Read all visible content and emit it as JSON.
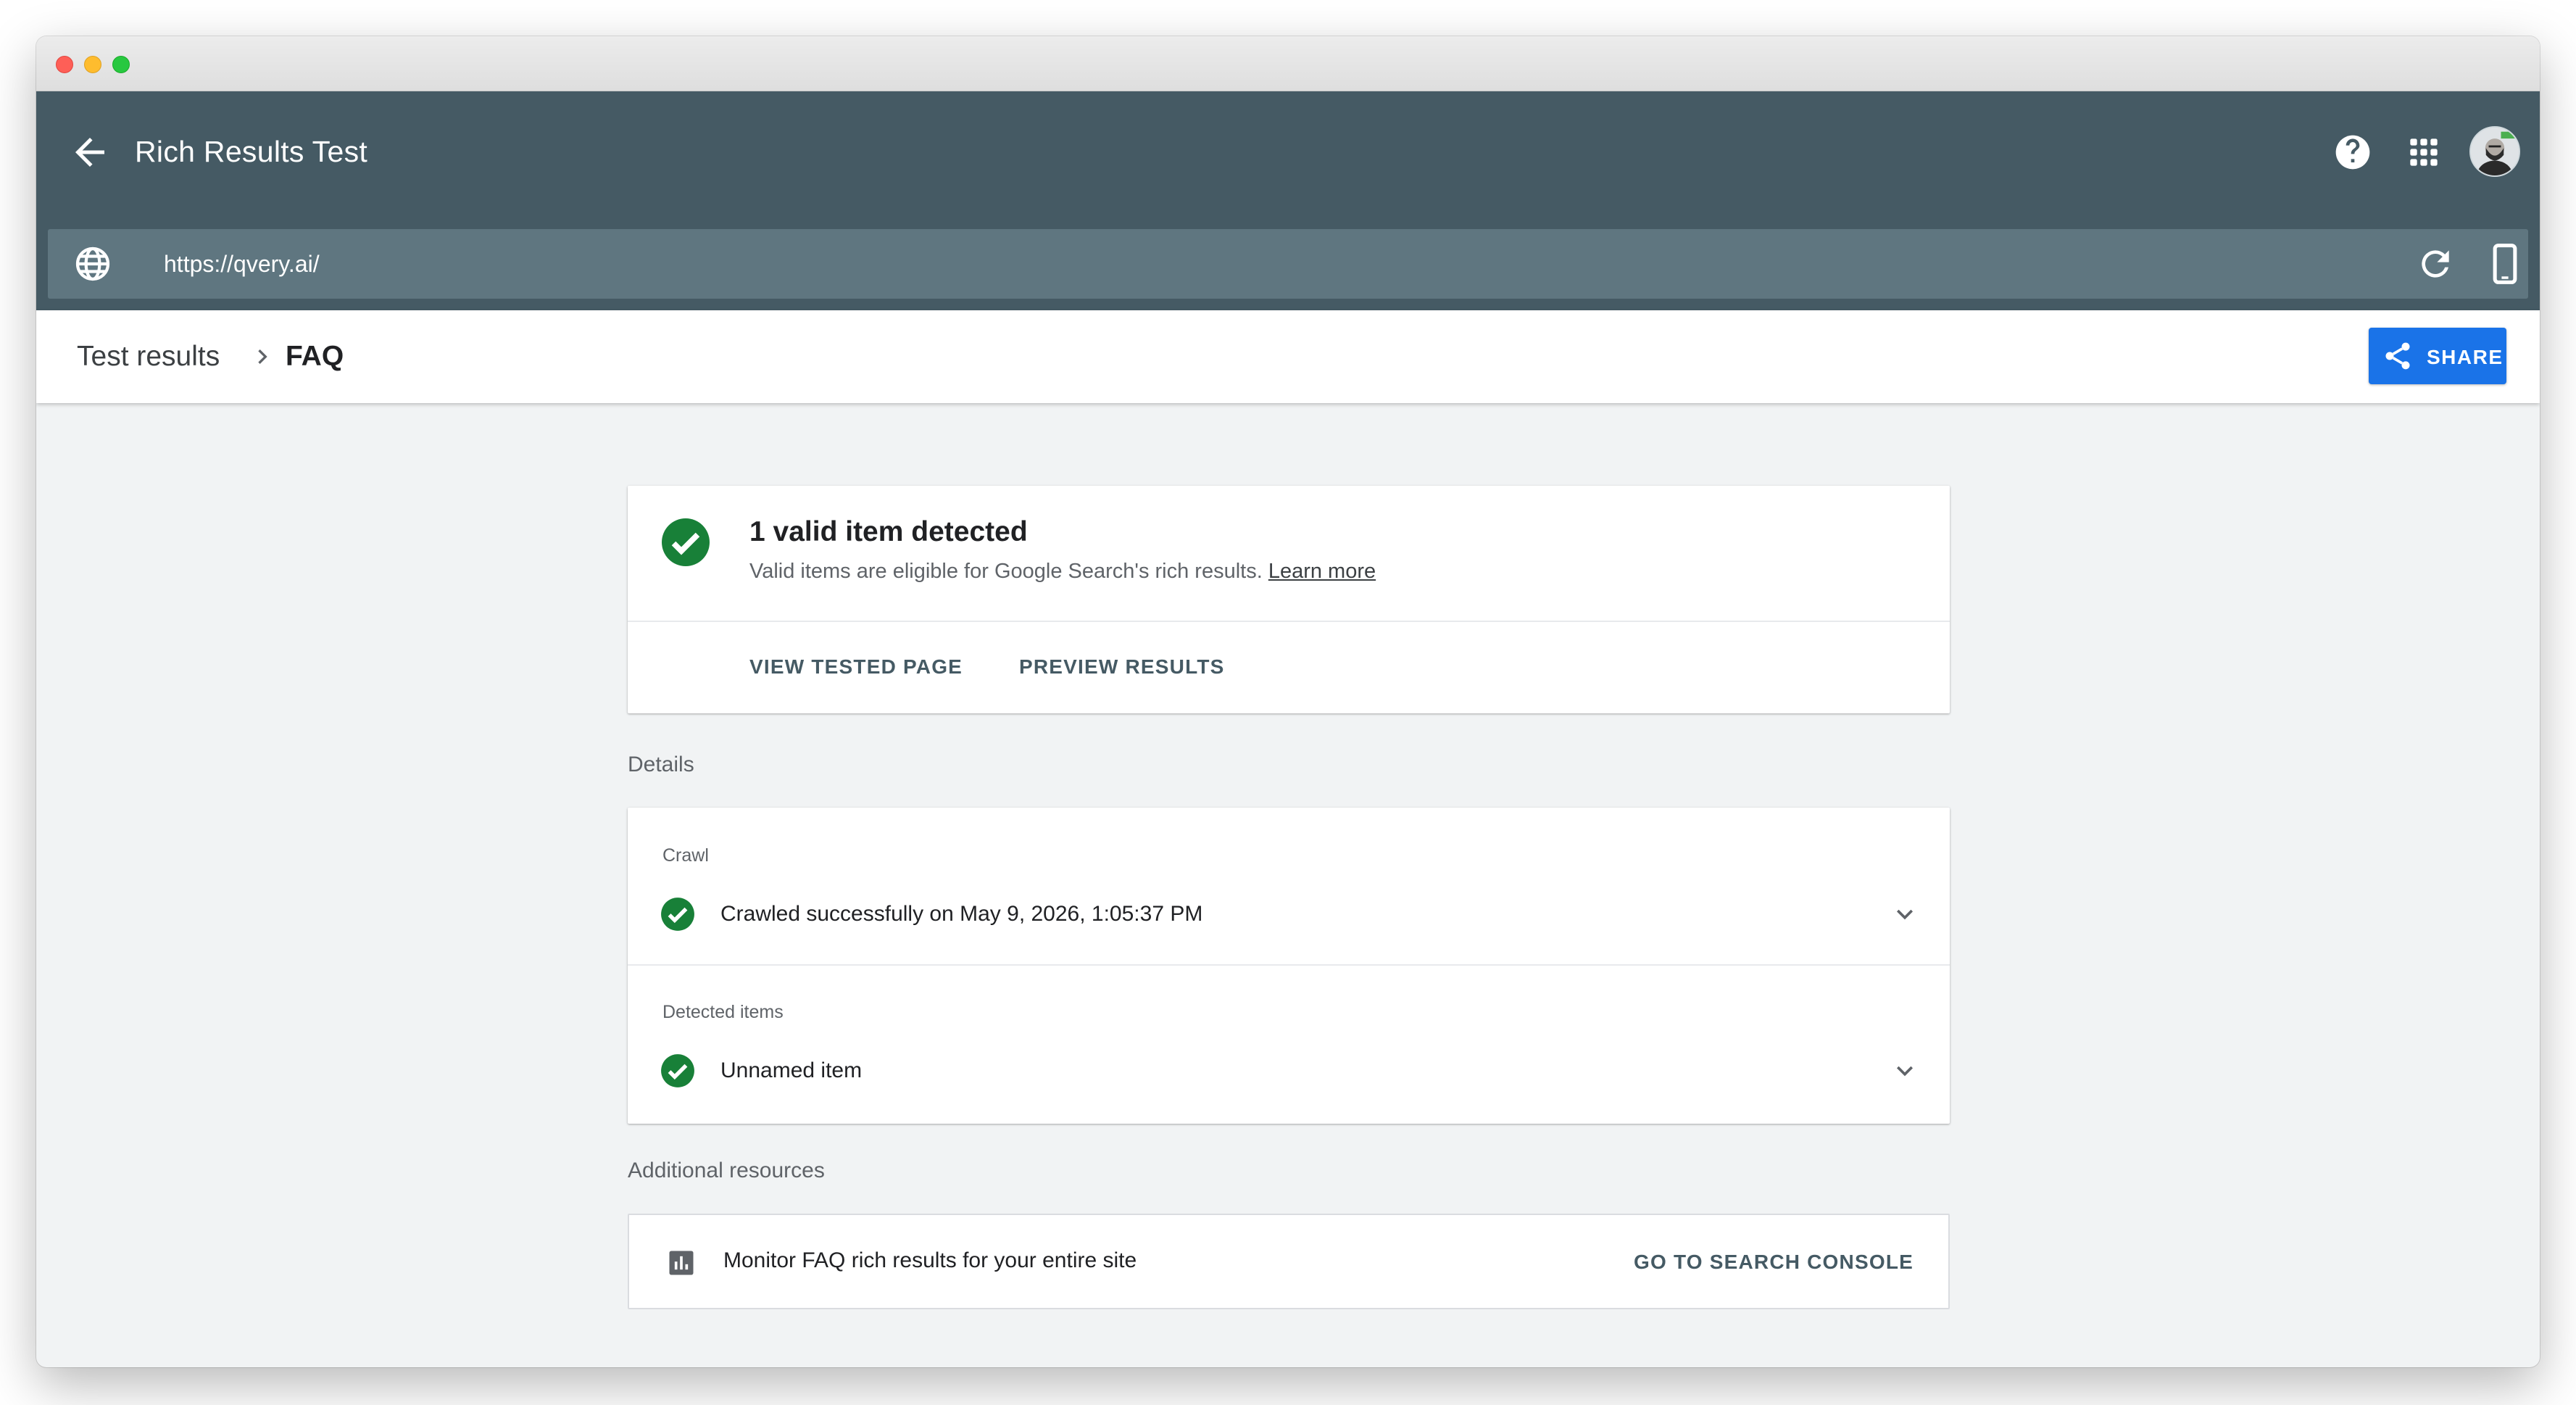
{
  "app": {
    "title": "Rich Results Test",
    "url": "https://qvery.ai/"
  },
  "icons": {
    "back": "arrow-back-icon",
    "help": "help-icon",
    "apps": "apps-grid-icon",
    "globe": "globe-icon",
    "refresh": "refresh-icon",
    "device": "smartphone-icon",
    "share": "share-icon",
    "check": "check-circle-icon",
    "chevron": "chevron-down-icon",
    "chart": "bar-chart-icon"
  },
  "breadcrumb": {
    "root": "Test results",
    "current": "FAQ"
  },
  "share_label": "SHARE",
  "summary": {
    "title": "1 valid item detected",
    "description": "Valid items are eligible for Google Search's rich results.",
    "learn_more": "Learn more",
    "actions": [
      "VIEW TESTED PAGE",
      "PREVIEW RESULTS"
    ]
  },
  "details": {
    "label": "Details",
    "crawl": {
      "heading": "Crawl",
      "status": "Crawled successfully on May 9, 2026, 1:05:37 PM"
    },
    "detected": {
      "heading": "Detected items",
      "item": "Unnamed item"
    }
  },
  "resources": {
    "label": "Additional resources",
    "text": "Monitor FAQ rich results for your entire site",
    "link": "GO TO SEARCH CONSOLE"
  },
  "colors": {
    "appbar": "#455a64",
    "urlbar": "#5f7680",
    "accent": "#1a73e8",
    "success": "#188038"
  }
}
